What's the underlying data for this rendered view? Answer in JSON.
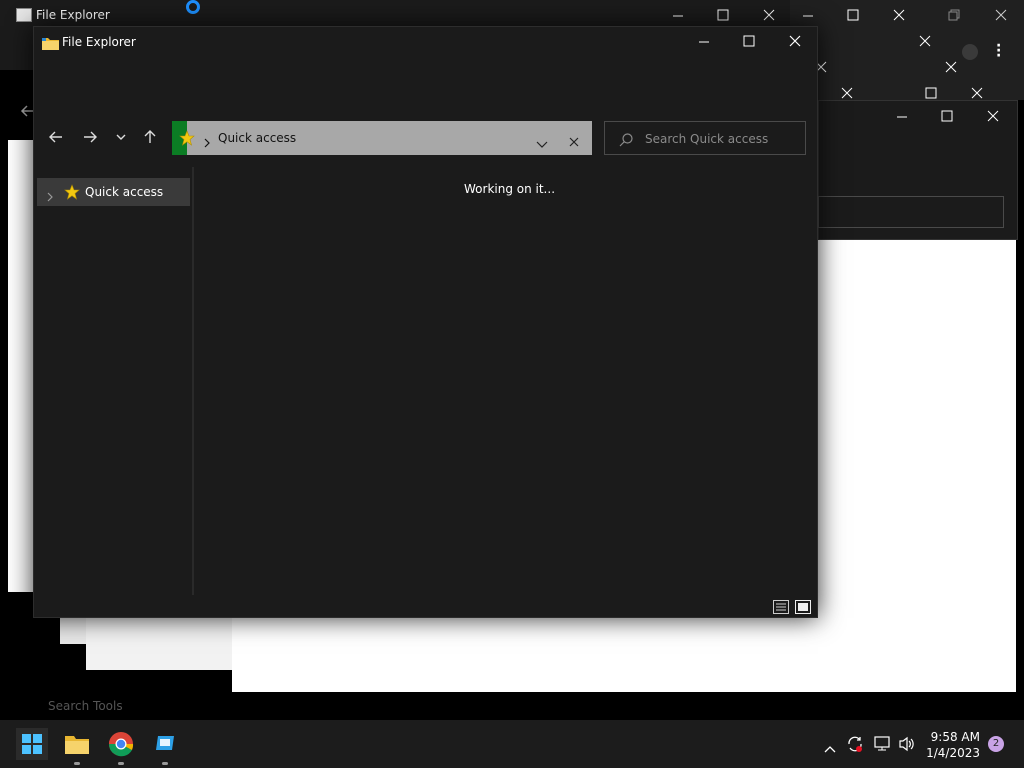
{
  "main_window": {
    "title": "File Explorer",
    "address_path": "Quick access",
    "search_placeholder": "Search Quick access",
    "nav_item": "Quick access",
    "status": "Working on it..."
  },
  "background_window": {
    "title": "File Explorer",
    "fragment_text": "Search Tools"
  },
  "taskbar": {
    "time": "9:58 AM",
    "date": "1/4/2023",
    "notification_count": "2"
  },
  "colors": {
    "window_bg": "#1b1b1b",
    "address_bg": "#a8a8a8",
    "address_accent": "#0b7d24",
    "taskbar_bg": "#1c1c1c"
  }
}
